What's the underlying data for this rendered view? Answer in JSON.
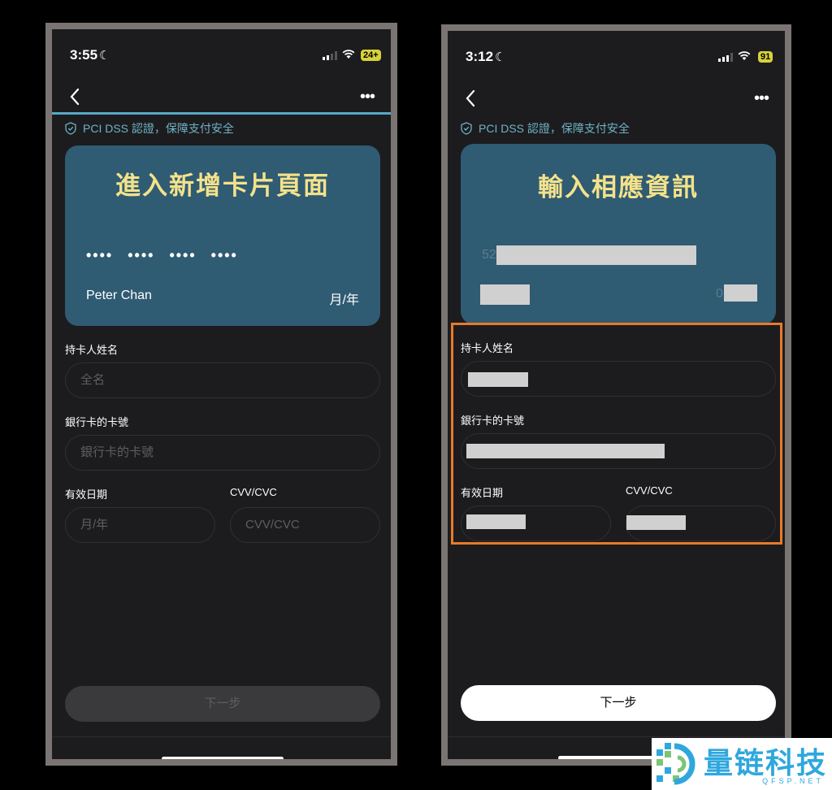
{
  "left": {
    "time": "3:55",
    "battery": "24+",
    "secure_text": "PCI DSS 認證，保障支付安全",
    "card_title": "進入新增卡片頁面",
    "card_number_groups": [
      "••••",
      "••••",
      "••••",
      "••••"
    ],
    "card_holder": "Peter Chan",
    "card_expiry": "月/年",
    "holder_label": "持卡人姓名",
    "holder_placeholder": "全名",
    "number_label": "銀行卡的卡號",
    "number_placeholder": "銀行卡的卡號",
    "expiry_label": "有效日期",
    "expiry_placeholder": "月/年",
    "cvv_label": "CVV/CVC",
    "cvv_placeholder": "CVV/CVC",
    "next_label": "下一步"
  },
  "right": {
    "time": "3:12",
    "battery": "91",
    "secure_text": "PCI DSS 認證，保障支付安全",
    "card_title": "輸入相應資訊",
    "card_number_prefix": "52",
    "card_expiry_prefix": "0",
    "holder_label": "持卡人姓名",
    "number_label": "銀行卡的卡號",
    "expiry_label": "有效日期",
    "cvv_label": "CVV/CVC",
    "next_label": "下一步"
  },
  "watermark": {
    "name": "量链科技",
    "sub": "QFSP.NET"
  },
  "colors": {
    "card": "#2f5b73",
    "card_title": "#f4e28a",
    "highlight": "#e8792b",
    "accent": "#58a8c8"
  }
}
